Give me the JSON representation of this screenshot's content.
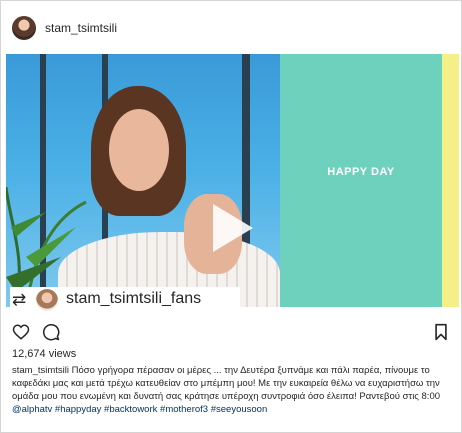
{
  "post": {
    "username": "stam_tsimtsili",
    "repost_account": "stam_tsimtsili_fans",
    "overlay_text": "HAPPY DAY",
    "views": "12,674 views",
    "caption": {
      "author": "stam_tsimtsili",
      "text": "Πόσο γρήγορα πέρασαν οι μέρες ... την Δευτέρα ξυπνάμε και πάλι παρέα, πίνουμε το καφεδάκι μας και μετά τρέχω κατευθείαν στο μπέμπη μου! Με την ευκαιρεία θέλω να ευχαριστήσω την ομάδα μου που ενωμένη και δυνατή σας κράτησε υπέροχη συντροφιά όσο έλειπα! Ραντεβού στις 8:00",
      "mention": "@alphatv",
      "hashtags": [
        "#happyday",
        "#backtowork",
        "#motherof3",
        "#seeyousoon"
      ]
    }
  },
  "icons": {
    "like": "heart-icon",
    "comment": "comment-icon",
    "save": "bookmark-icon",
    "repost": "repost-icon",
    "play": "play-icon"
  },
  "colors": {
    "green_panel": "#6ed1be",
    "yellow_strip": "#f5ef87",
    "hashtag": "#003569"
  }
}
